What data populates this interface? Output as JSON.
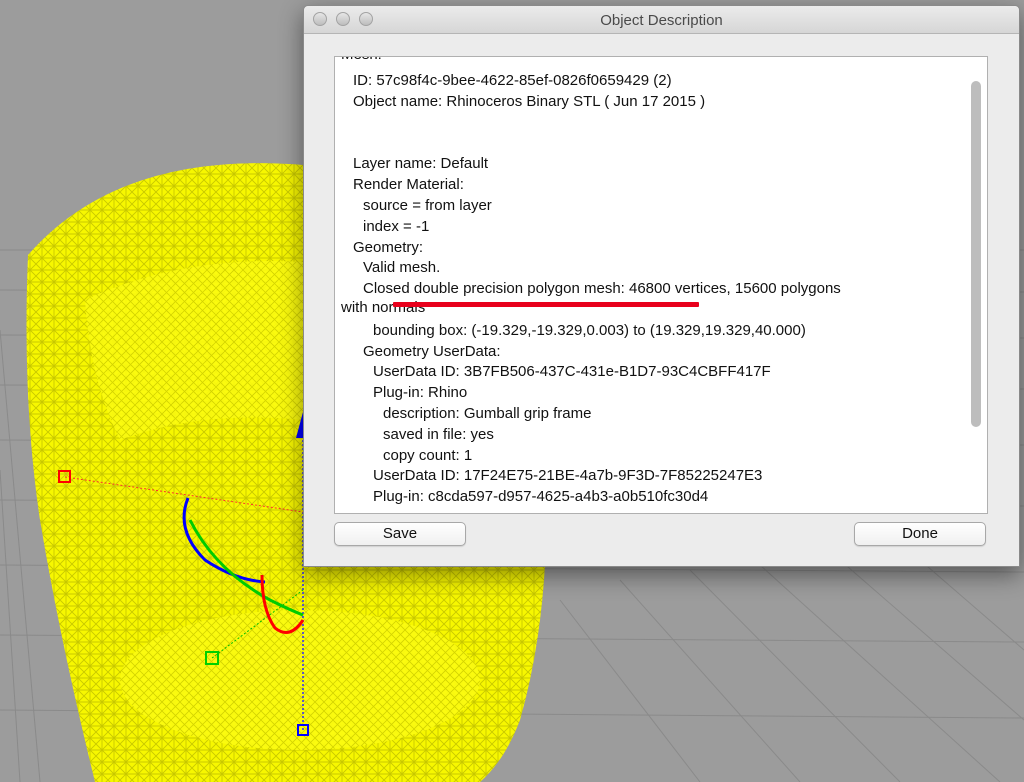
{
  "dialog": {
    "title": "Object Description",
    "clipped_top_text": "Mesh:",
    "lines": [
      "ID: 57c98f4c-9bee-4622-85ef-0826f0659429 (2)",
      "Object name: Rhinoceros Binary STL ( Jun 17 2015 )",
      "",
      "",
      "Layer name: Default",
      "Render Material:",
      "source = from layer",
      "index = -1",
      "Geometry:",
      "Valid mesh.",
      "Closed double precision polygon mesh: 46800 vertices, 15600 polygons",
      "with normals",
      "bounding box: (-19.329,-19.329,0.003) to (19.329,19.329,40.000)",
      "Geometry UserData:",
      "UserData ID: 3B7FB506-437C-431e-B1D7-93C4CBFF417F",
      "Plug-in: Rhino",
      "description: Gumball grip frame",
      "saved in file: yes",
      "copy count: 1",
      "UserData ID: 17F24E75-21BE-4a7b-9F3D-7F85225247E3",
      "Plug-in: c8cda597-d957-4625-a4b3-a0b510fc30d4"
    ],
    "save_label": "Save",
    "done_label": "Done"
  },
  "colors": {
    "mesh": "#ffff00",
    "annotation_underline": "#e8001c",
    "gumball_x": "#ff0000",
    "gumball_y": "#00d000",
    "gumball_z": "#0000ff"
  }
}
